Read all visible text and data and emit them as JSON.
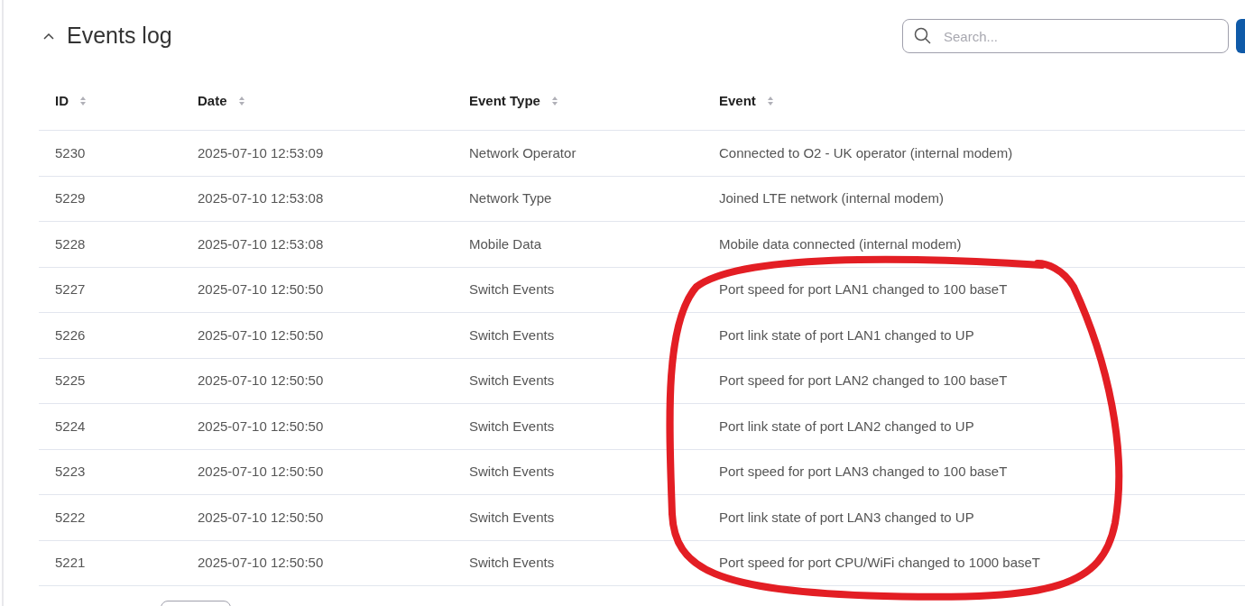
{
  "panel": {
    "title": "Events log",
    "expanded": true
  },
  "search": {
    "placeholder": "Search..."
  },
  "table": {
    "columns": [
      "ID",
      "Date",
      "Event Type",
      "Event"
    ],
    "rows": [
      [
        "5230",
        "2025-07-10 12:53:09",
        "Network Operator",
        "Connected to O2 - UK operator (internal modem)"
      ],
      [
        "5229",
        "2025-07-10 12:53:08",
        "Network Type",
        "Joined LTE network (internal modem)"
      ],
      [
        "5228",
        "2025-07-10 12:53:08",
        "Mobile Data",
        "Mobile data connected (internal modem)"
      ],
      [
        "5227",
        "2025-07-10 12:50:50",
        "Switch Events",
        "Port speed for port LAN1 changed to 100 baseT"
      ],
      [
        "5226",
        "2025-07-10 12:50:50",
        "Switch Events",
        "Port link state of port LAN1 changed to UP"
      ],
      [
        "5225",
        "2025-07-10 12:50:50",
        "Switch Events",
        "Port speed for port LAN2 changed to 100 baseT"
      ],
      [
        "5224",
        "2025-07-10 12:50:50",
        "Switch Events",
        "Port link state of port LAN2 changed to UP"
      ],
      [
        "5223",
        "2025-07-10 12:50:50",
        "Switch Events",
        "Port speed for port LAN3 changed to 100 baseT"
      ],
      [
        "5222",
        "2025-07-10 12:50:50",
        "Switch Events",
        "Port link state of port LAN3 changed to UP"
      ],
      [
        "5221",
        "2025-07-10 12:50:50",
        "Switch Events",
        "Port speed for port CPU/WiFi changed to 1000 baseT"
      ]
    ]
  }
}
